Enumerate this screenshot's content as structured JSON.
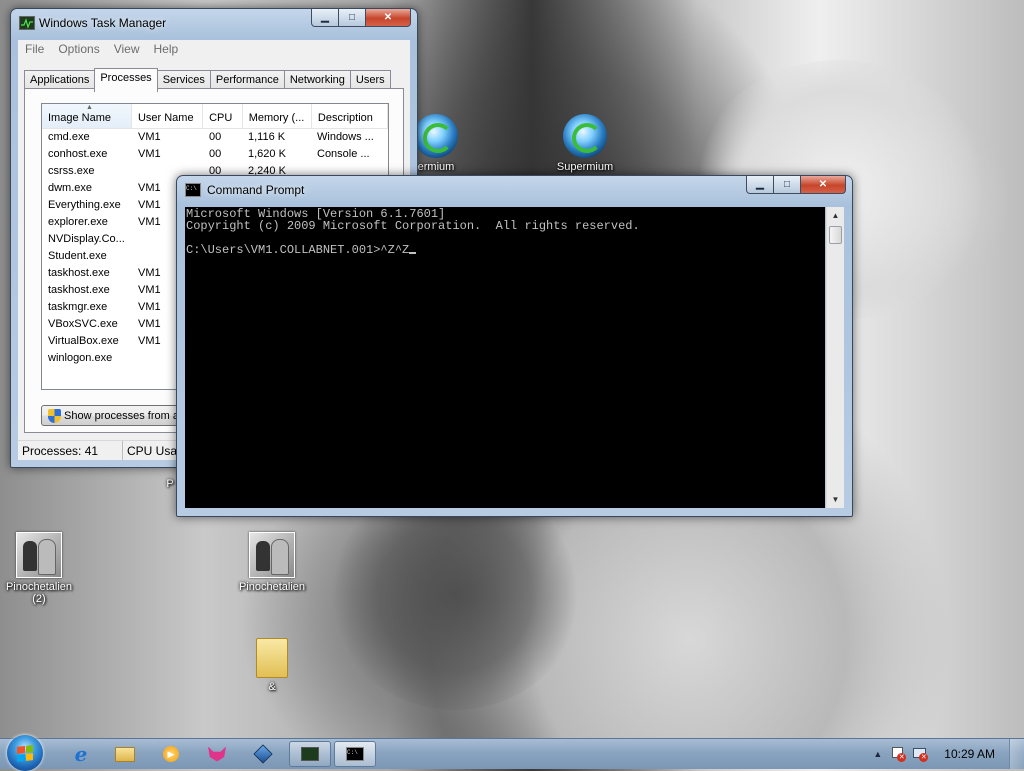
{
  "desktop": {
    "icons": [
      {
        "label": "Pinochetalien",
        "sublabel": "(2)"
      },
      {
        "label": "Pinochetalien",
        "sublabel": ""
      },
      {
        "label": "&",
        "sublabel": ""
      },
      {
        "label": "ermium",
        "sublabel": ""
      },
      {
        "label": "Supermium",
        "sublabel": ""
      },
      {
        "label": "P",
        "sublabel": ""
      }
    ]
  },
  "task_manager": {
    "title": "Windows Task Manager",
    "menu": [
      "File",
      "Options",
      "View",
      "Help"
    ],
    "tabs": [
      "Applications",
      "Processes",
      "Services",
      "Performance",
      "Networking",
      "Users"
    ],
    "active_tab": "Processes",
    "columns": [
      "Image Name",
      "User Name",
      "CPU",
      "Memory (...",
      "Description"
    ],
    "rows": [
      {
        "image": "cmd.exe",
        "user": "VM1",
        "cpu": "00",
        "memory": "1,116 K",
        "desc": "Windows ..."
      },
      {
        "image": "conhost.exe",
        "user": "VM1",
        "cpu": "00",
        "memory": "1,620 K",
        "desc": "Console ..."
      },
      {
        "image": "csrss.exe",
        "user": "",
        "cpu": "00",
        "memory": "2,240 K",
        "desc": ""
      },
      {
        "image": "dwm.exe",
        "user": "VM1",
        "cpu": "",
        "memory": "",
        "desc": ""
      },
      {
        "image": "Everything.exe",
        "user": "VM1",
        "cpu": "",
        "memory": "",
        "desc": ""
      },
      {
        "image": "explorer.exe",
        "user": "VM1",
        "cpu": "",
        "memory": "",
        "desc": ""
      },
      {
        "image": "NVDisplay.Co...",
        "user": "",
        "cpu": "",
        "memory": "",
        "desc": ""
      },
      {
        "image": "Student.exe",
        "user": "",
        "cpu": "",
        "memory": "",
        "desc": ""
      },
      {
        "image": "taskhost.exe",
        "user": "VM1",
        "cpu": "",
        "memory": "",
        "desc": ""
      },
      {
        "image": "taskhost.exe",
        "user": "VM1",
        "cpu": "",
        "memory": "",
        "desc": ""
      },
      {
        "image": "taskmgr.exe",
        "user": "VM1",
        "cpu": "",
        "memory": "",
        "desc": ""
      },
      {
        "image": "VBoxSVC.exe",
        "user": "VM1",
        "cpu": "",
        "memory": "",
        "desc": ""
      },
      {
        "image": "VirtualBox.exe",
        "user": "VM1",
        "cpu": "",
        "memory": "",
        "desc": ""
      },
      {
        "image": "winlogon.exe",
        "user": "",
        "cpu": "",
        "memory": "",
        "desc": ""
      }
    ],
    "show_all_button": "Show processes from a",
    "status": {
      "processes": "Processes: 41",
      "cpu": "CPU Usag"
    }
  },
  "command_prompt": {
    "title": "Command Prompt",
    "lines": [
      "Microsoft Windows [Version 6.1.7601]",
      "Copyright (c) 2009 Microsoft Corporation.  All rights reserved.",
      "",
      "C:\\Users\\VM1.COLLABNET.001>^Z^Z"
    ]
  },
  "taskbar": {
    "pinned": [
      "start-orb",
      "internet-explorer",
      "windows-explorer",
      "media-player",
      "firefox-like-app",
      "virtualbox",
      "task-manager",
      "command-prompt"
    ],
    "clock": "10:29 AM"
  },
  "colors": {
    "console_bg": "#000000",
    "console_fg": "#c0c0c0",
    "close_button": "#c7452a",
    "taskbar": "#8aa4c0"
  }
}
